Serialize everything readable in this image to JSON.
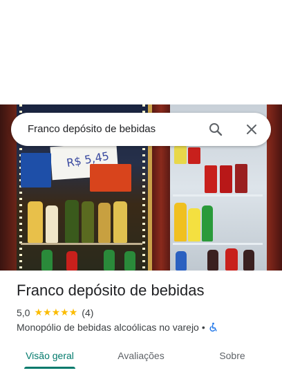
{
  "search": {
    "query": "Franco depósito de bebidas"
  },
  "place": {
    "name": "Franco depósito de bebidas",
    "rating": "5,0",
    "stars": [
      "★",
      "★",
      "★",
      "★",
      "★"
    ],
    "review_count": "(4)",
    "category": "Monopólio de bebidas alcoólicas no varejo",
    "separator": "•",
    "photo_sign": "R$ 5,45"
  },
  "tabs": [
    {
      "label": "Visão geral",
      "active": true
    },
    {
      "label": "Avaliações",
      "active": false
    },
    {
      "label": "Sobre",
      "active": false
    }
  ],
  "colors": {
    "accent": "#00796b",
    "star": "#fbbc04",
    "accessibility_icon": "#1a73e8"
  },
  "icons": {
    "search": "search-icon",
    "close": "close-icon",
    "accessibility": "wheelchair-accessible-icon"
  }
}
